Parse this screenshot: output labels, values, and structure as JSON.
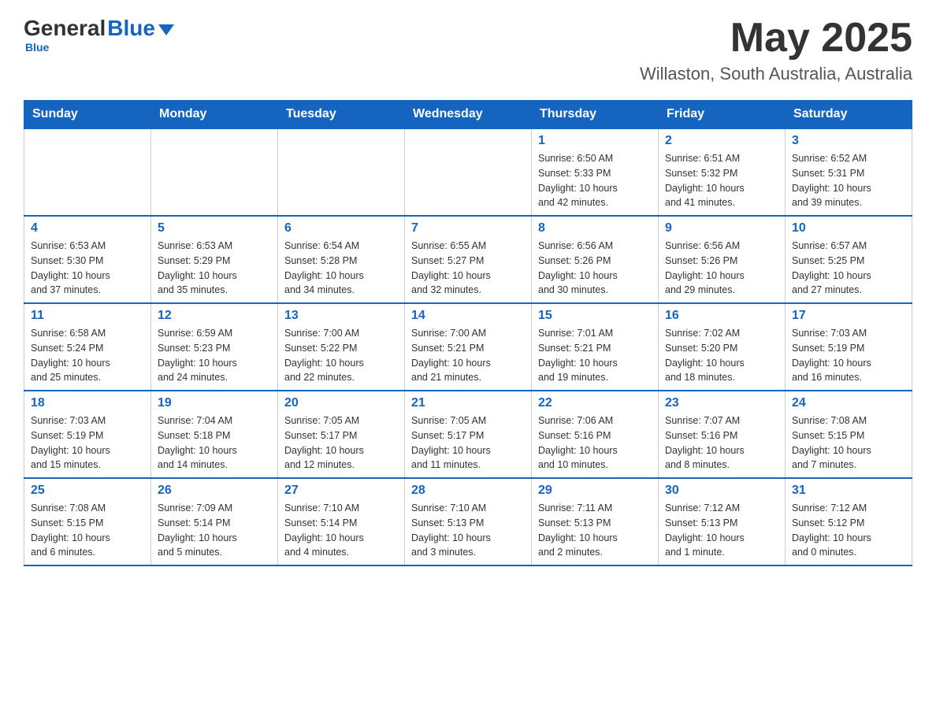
{
  "header": {
    "logo_general": "General",
    "logo_blue": "Blue",
    "month": "May 2025",
    "location": "Willaston, South Australia, Australia"
  },
  "weekdays": [
    "Sunday",
    "Monday",
    "Tuesday",
    "Wednesday",
    "Thursday",
    "Friday",
    "Saturday"
  ],
  "weeks": [
    [
      {
        "day": "",
        "info": ""
      },
      {
        "day": "",
        "info": ""
      },
      {
        "day": "",
        "info": ""
      },
      {
        "day": "",
        "info": ""
      },
      {
        "day": "1",
        "info": "Sunrise: 6:50 AM\nSunset: 5:33 PM\nDaylight: 10 hours\nand 42 minutes."
      },
      {
        "day": "2",
        "info": "Sunrise: 6:51 AM\nSunset: 5:32 PM\nDaylight: 10 hours\nand 41 minutes."
      },
      {
        "day": "3",
        "info": "Sunrise: 6:52 AM\nSunset: 5:31 PM\nDaylight: 10 hours\nand 39 minutes."
      }
    ],
    [
      {
        "day": "4",
        "info": "Sunrise: 6:53 AM\nSunset: 5:30 PM\nDaylight: 10 hours\nand 37 minutes."
      },
      {
        "day": "5",
        "info": "Sunrise: 6:53 AM\nSunset: 5:29 PM\nDaylight: 10 hours\nand 35 minutes."
      },
      {
        "day": "6",
        "info": "Sunrise: 6:54 AM\nSunset: 5:28 PM\nDaylight: 10 hours\nand 34 minutes."
      },
      {
        "day": "7",
        "info": "Sunrise: 6:55 AM\nSunset: 5:27 PM\nDaylight: 10 hours\nand 32 minutes."
      },
      {
        "day": "8",
        "info": "Sunrise: 6:56 AM\nSunset: 5:26 PM\nDaylight: 10 hours\nand 30 minutes."
      },
      {
        "day": "9",
        "info": "Sunrise: 6:56 AM\nSunset: 5:26 PM\nDaylight: 10 hours\nand 29 minutes."
      },
      {
        "day": "10",
        "info": "Sunrise: 6:57 AM\nSunset: 5:25 PM\nDaylight: 10 hours\nand 27 minutes."
      }
    ],
    [
      {
        "day": "11",
        "info": "Sunrise: 6:58 AM\nSunset: 5:24 PM\nDaylight: 10 hours\nand 25 minutes."
      },
      {
        "day": "12",
        "info": "Sunrise: 6:59 AM\nSunset: 5:23 PM\nDaylight: 10 hours\nand 24 minutes."
      },
      {
        "day": "13",
        "info": "Sunrise: 7:00 AM\nSunset: 5:22 PM\nDaylight: 10 hours\nand 22 minutes."
      },
      {
        "day": "14",
        "info": "Sunrise: 7:00 AM\nSunset: 5:21 PM\nDaylight: 10 hours\nand 21 minutes."
      },
      {
        "day": "15",
        "info": "Sunrise: 7:01 AM\nSunset: 5:21 PM\nDaylight: 10 hours\nand 19 minutes."
      },
      {
        "day": "16",
        "info": "Sunrise: 7:02 AM\nSunset: 5:20 PM\nDaylight: 10 hours\nand 18 minutes."
      },
      {
        "day": "17",
        "info": "Sunrise: 7:03 AM\nSunset: 5:19 PM\nDaylight: 10 hours\nand 16 minutes."
      }
    ],
    [
      {
        "day": "18",
        "info": "Sunrise: 7:03 AM\nSunset: 5:19 PM\nDaylight: 10 hours\nand 15 minutes."
      },
      {
        "day": "19",
        "info": "Sunrise: 7:04 AM\nSunset: 5:18 PM\nDaylight: 10 hours\nand 14 minutes."
      },
      {
        "day": "20",
        "info": "Sunrise: 7:05 AM\nSunset: 5:17 PM\nDaylight: 10 hours\nand 12 minutes."
      },
      {
        "day": "21",
        "info": "Sunrise: 7:05 AM\nSunset: 5:17 PM\nDaylight: 10 hours\nand 11 minutes."
      },
      {
        "day": "22",
        "info": "Sunrise: 7:06 AM\nSunset: 5:16 PM\nDaylight: 10 hours\nand 10 minutes."
      },
      {
        "day": "23",
        "info": "Sunrise: 7:07 AM\nSunset: 5:16 PM\nDaylight: 10 hours\nand 8 minutes."
      },
      {
        "day": "24",
        "info": "Sunrise: 7:08 AM\nSunset: 5:15 PM\nDaylight: 10 hours\nand 7 minutes."
      }
    ],
    [
      {
        "day": "25",
        "info": "Sunrise: 7:08 AM\nSunset: 5:15 PM\nDaylight: 10 hours\nand 6 minutes."
      },
      {
        "day": "26",
        "info": "Sunrise: 7:09 AM\nSunset: 5:14 PM\nDaylight: 10 hours\nand 5 minutes."
      },
      {
        "day": "27",
        "info": "Sunrise: 7:10 AM\nSunset: 5:14 PM\nDaylight: 10 hours\nand 4 minutes."
      },
      {
        "day": "28",
        "info": "Sunrise: 7:10 AM\nSunset: 5:13 PM\nDaylight: 10 hours\nand 3 minutes."
      },
      {
        "day": "29",
        "info": "Sunrise: 7:11 AM\nSunset: 5:13 PM\nDaylight: 10 hours\nand 2 minutes."
      },
      {
        "day": "30",
        "info": "Sunrise: 7:12 AM\nSunset: 5:13 PM\nDaylight: 10 hours\nand 1 minute."
      },
      {
        "day": "31",
        "info": "Sunrise: 7:12 AM\nSunset: 5:12 PM\nDaylight: 10 hours\nand 0 minutes."
      }
    ]
  ]
}
